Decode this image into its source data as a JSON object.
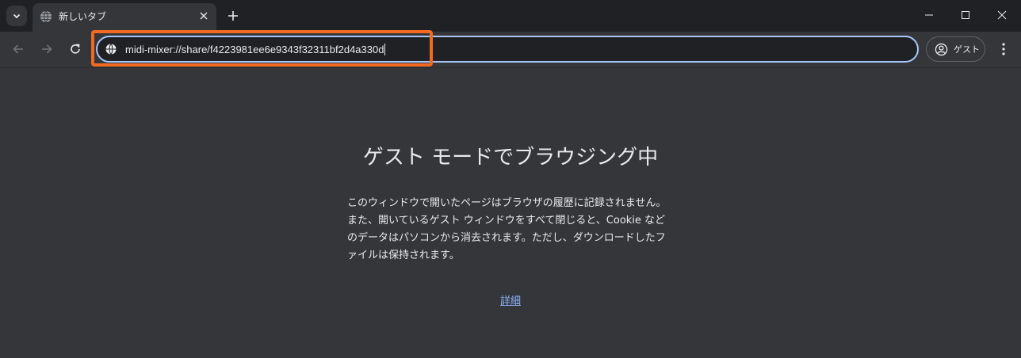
{
  "window": {
    "tab_title": "新しいタブ",
    "tab_favicon": "globe-icon"
  },
  "toolbar": {
    "url": "midi-mixer://share/f4223981ee6e9343f32311bf2d4a330d",
    "site_info_icon": "globe-icon",
    "profile_label": "ゲスト",
    "profile_icon": "person-circle-icon"
  },
  "page": {
    "title": "ゲスト モードでブラウジング中",
    "description": "このウィンドウで開いたページはブラウザの履歴に記録されません。また、開いているゲスト ウィンドウをすべて閉じると、Cookie などのデータはパソコンから消去されます。ただし、ダウンロードしたファイルは保持されます。",
    "learn_more": "詳細"
  },
  "colors": {
    "highlight": "#f26a21",
    "link": "#8ab4f8",
    "omnibox_focus": "#a8c7fa"
  }
}
